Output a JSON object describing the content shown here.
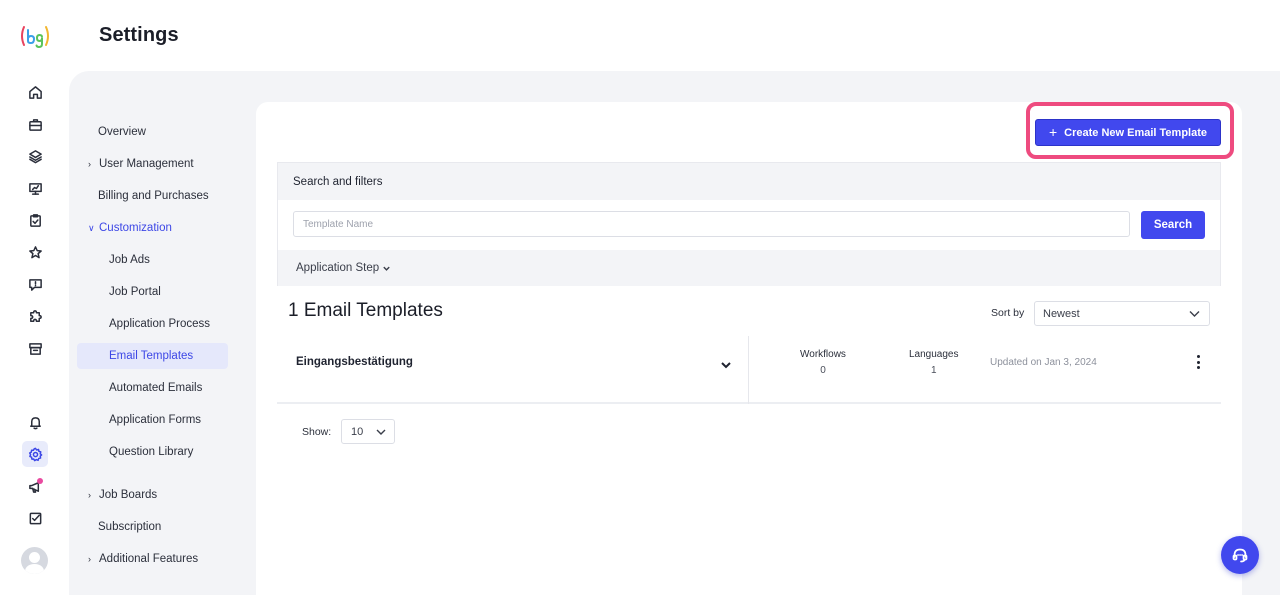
{
  "header": {
    "title": "Settings"
  },
  "brand": {
    "logo_text": "(bg)",
    "accent": "#4148ee",
    "highlight": "#ee4b7f"
  },
  "rail": {
    "icons": [
      "home-icon",
      "briefcase-icon",
      "layers-icon",
      "presentation-icon",
      "clipboard-check-icon",
      "star-icon",
      "chat-icon",
      "puzzle-icon",
      "archive-icon",
      "bell-icon",
      "gear-icon",
      "megaphone-icon",
      "checkbox-icon"
    ],
    "active": "gear-icon"
  },
  "settings_nav": {
    "overview": "Overview",
    "user_management": "User Management",
    "billing": "Billing and Purchases",
    "customization": "Customization",
    "job_ads": "Job Ads",
    "job_portal": "Job Portal",
    "application_process": "Application Process",
    "email_templates": "Email Templates",
    "automated_emails": "Automated Emails",
    "application_forms": "Application Forms",
    "question_library": "Question Library",
    "job_boards": "Job Boards",
    "subscription": "Subscription",
    "additional_features": "Additional Features"
  },
  "toolbar": {
    "create_label": "Create New Email Template",
    "create_plus": "+"
  },
  "filters": {
    "title": "Search and filters",
    "search_placeholder": "Template Name",
    "search_label": "Search",
    "application_step": "Application Step"
  },
  "list": {
    "count_title": "1 Email Templates",
    "sort_label": "Sort by",
    "sort_value": "Newest",
    "rows": [
      {
        "name": "Eingangsbestätigung",
        "workflows_label": "Workflows",
        "workflows_value": "0",
        "languages_label": "Languages",
        "languages_value": "1",
        "updated": "Updated on Jan 3, 2024"
      }
    ]
  },
  "pagination": {
    "show_label": "Show:",
    "show_value": "10"
  }
}
